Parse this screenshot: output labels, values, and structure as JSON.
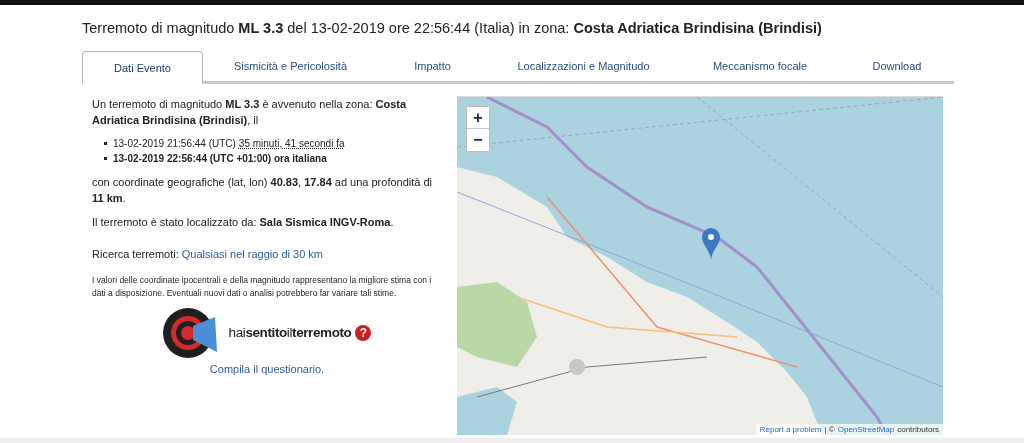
{
  "title": "Terremoto di magnitudo **ML 3.3** del 13-02-2019 ore 22:56:44 (Italia) in zona: **Costa Adriatica Brindisina (Brindisi)**",
  "tabs": [
    {
      "label": "Dati Evento",
      "selected": true
    },
    {
      "label": "Sismicità e Pericolosità",
      "selected": false
    },
    {
      "label": "Impatto",
      "selected": false
    },
    {
      "label": "Localizzazioni e Magnitudo",
      "selected": false
    },
    {
      "label": "Meccanismo focale",
      "selected": false
    },
    {
      "label": "Download",
      "selected": false
    }
  ],
  "intro": "Un terremoto di magnitudo **ML 3.3** è avvenuto nella zona: **Costa Adriatica Brindisina (Brindisi)**, il",
  "times": [
    {
      "text": "13-02-2019 21:56:44 (UTC)",
      "ago": "35 minuti, 41 secondi fa",
      "bold": false
    },
    {
      "text": "13-02-2019 22:56:44 (UTC +01:00) ora italiana",
      "bold": true
    }
  ],
  "coordinates": "con coordinate geografiche (lat, lon) **40.83**, **17.84** ad una profondità di **11 km**.",
  "located_by": "Il terremoto è stato localizzato da: **Sala Sismica INGV-Roma**.",
  "search": {
    "label": "Ricerca terremoti:",
    "link": "Qualsiasi nel raggio di 30 km"
  },
  "disclaimer": "I valori delle coordinate ipocentrali e della magnitudo rappresentano la migliore stima con i dati a disposizione. Eventuali nuovi dati o analisi potrebbero far variare tali stime.",
  "survey": {
    "logo_parts": [
      "hai",
      "sentito",
      "il",
      "terremoto"
    ],
    "logo_badge": "?",
    "link": "Compila il questionario."
  },
  "map": {
    "kind": "picture",
    "zoom_in": "+",
    "zoom_out": "−",
    "attribution": {
      "report": "Report a problem",
      "separator": "| ©",
      "osm": "OpenStreetMap",
      "suffix": "contributors"
    }
  }
}
